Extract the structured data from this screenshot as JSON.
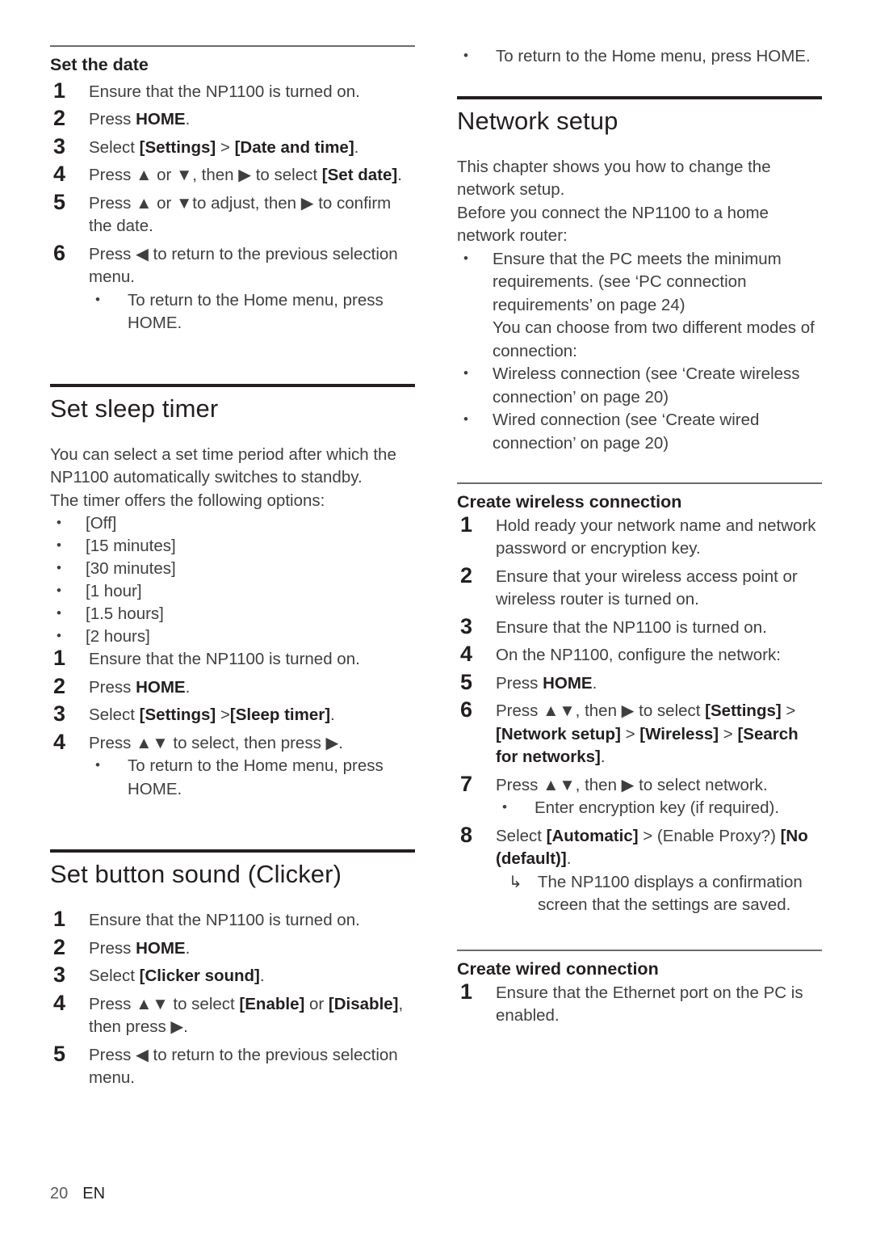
{
  "document": {
    "footer": {
      "page_number": "20",
      "language": "EN"
    }
  },
  "left_column": {
    "set_the_date": {
      "heading": "Set the date",
      "steps": [
        {
          "num": "1",
          "text": "Ensure that the NP1100 is turned on."
        },
        {
          "num": "2",
          "text_prefix": "Press ",
          "bold": "HOME",
          "text_suffix": "."
        },
        {
          "num": "3",
          "text_prefix": "Select ",
          "bold1": "[Settings]",
          "mid": " > ",
          "bold2": "[Date and time]",
          "text_suffix": "."
        },
        {
          "num": "4",
          "text": "Press ▲ or ▼, then ▶ to select ",
          "bold": "[Set date]",
          "text_suffix": "."
        },
        {
          "num": "5",
          "text": "Press ▲ or ▼to adjust, then ▶ to confirm the date."
        },
        {
          "num": "6",
          "text": "Press ◀ to return to the previous selection menu."
        }
      ],
      "sub_bullet": "To return to the Home menu, press HOME."
    },
    "set_sleep_timer": {
      "heading": "Set sleep timer",
      "intro_line1": "You can select a set time period after which the NP1100 automatically switches to standby.",
      "intro_line2": "The timer offers the following options:",
      "options": [
        "[Off]",
        "[15 minutes]",
        "[30 minutes]",
        "[1 hour]",
        "[1.5 hours]",
        "[2 hours]"
      ],
      "steps": [
        {
          "num": "1",
          "text": "Ensure that the NP1100 is turned on."
        },
        {
          "num": "2",
          "text_prefix": "Press ",
          "bold": "HOME",
          "text_suffix": "."
        },
        {
          "num": "3",
          "text_prefix": "Select ",
          "bold1": "[Settings]",
          "mid": " >",
          "bold2": "[Sleep timer]",
          "text_suffix": "."
        },
        {
          "num": "4",
          "text": "Press ▲▼ to select, then press ▶."
        }
      ],
      "sub_bullet": "To return to the Home menu, press HOME."
    },
    "set_button_sound": {
      "heading": "Set button sound (Clicker)",
      "steps": [
        {
          "num": "1",
          "text": "Ensure that the NP1100 is turned on."
        },
        {
          "num": "2",
          "text_prefix": "Press ",
          "bold": "HOME",
          "text_suffix": "."
        },
        {
          "num": "3",
          "text_prefix": "Select ",
          "bold": "[Clicker sound]",
          "text_suffix": "."
        },
        {
          "num": "4",
          "text_prefix": "Press ▲▼ to select ",
          "bold1": "[Enable]",
          "mid": " or ",
          "bold2": "[Disable]",
          "text_suffix": ", then press ▶."
        },
        {
          "num": "5",
          "text": "Press ◀ to return to the previous selection menu."
        }
      ]
    }
  },
  "right_column": {
    "top_bullet": "To return to the Home menu, press HOME.",
    "network_setup": {
      "heading": "Network setup",
      "intro_line1": "This chapter shows you how to change the network setup.",
      "intro_line2": "Before you connect the NP1100 to a home network router:",
      "bullets": [
        {
          "text": "Ensure that the PC meets the minimum requirements. (see ‘PC connection requirements’ on page 24)",
          "continuation": "You can choose from two different modes of connection:"
        },
        {
          "text": "Wireless connection (see ‘Create wireless connection’ on page 20)"
        },
        {
          "text": "Wired connection (see ‘Create wired connection’ on page 20)"
        }
      ]
    },
    "create_wireless_connection": {
      "heading": "Create wireless connection",
      "steps": [
        {
          "num": "1",
          "text": "Hold ready your network name and network password or encryption key."
        },
        {
          "num": "2",
          "text": "Ensure that your wireless access point or wireless router is turned on."
        },
        {
          "num": "3",
          "text": "Ensure that the NP1100 is turned on."
        },
        {
          "num": "4",
          "text": "On the NP1100, configure the network:"
        },
        {
          "num": "5",
          "text_prefix": "Press ",
          "bold": "HOME",
          "text_suffix": "."
        },
        {
          "num": "6",
          "text_prefix": "Press ▲▼, then ▶ to select ",
          "bold1": "[Settings]",
          "mid1": " > ",
          "bold2": "[Network setup]",
          "mid2": " > ",
          "bold3": "[Wireless]",
          "mid3": " > ",
          "bold4": "[Search for networks]",
          "text_suffix": "."
        },
        {
          "num": "7",
          "text": "Press ▲▼, then ▶ to select network."
        },
        {
          "num": "8",
          "text_prefix": "Select ",
          "bold1": "[Automatic]",
          "mid1": " > (Enable Proxy?) ",
          "bold2": "[No (default)]",
          "text_suffix": "."
        }
      ],
      "step7_bullet": "Enter encryption key (if required).",
      "step8_result": "The NP1100 displays a confirmation screen that the settings are saved."
    },
    "create_wired_connection": {
      "heading": "Create wired connection",
      "steps": [
        {
          "num": "1",
          "text": "Ensure that the Ethernet port on the PC is enabled."
        }
      ]
    }
  }
}
